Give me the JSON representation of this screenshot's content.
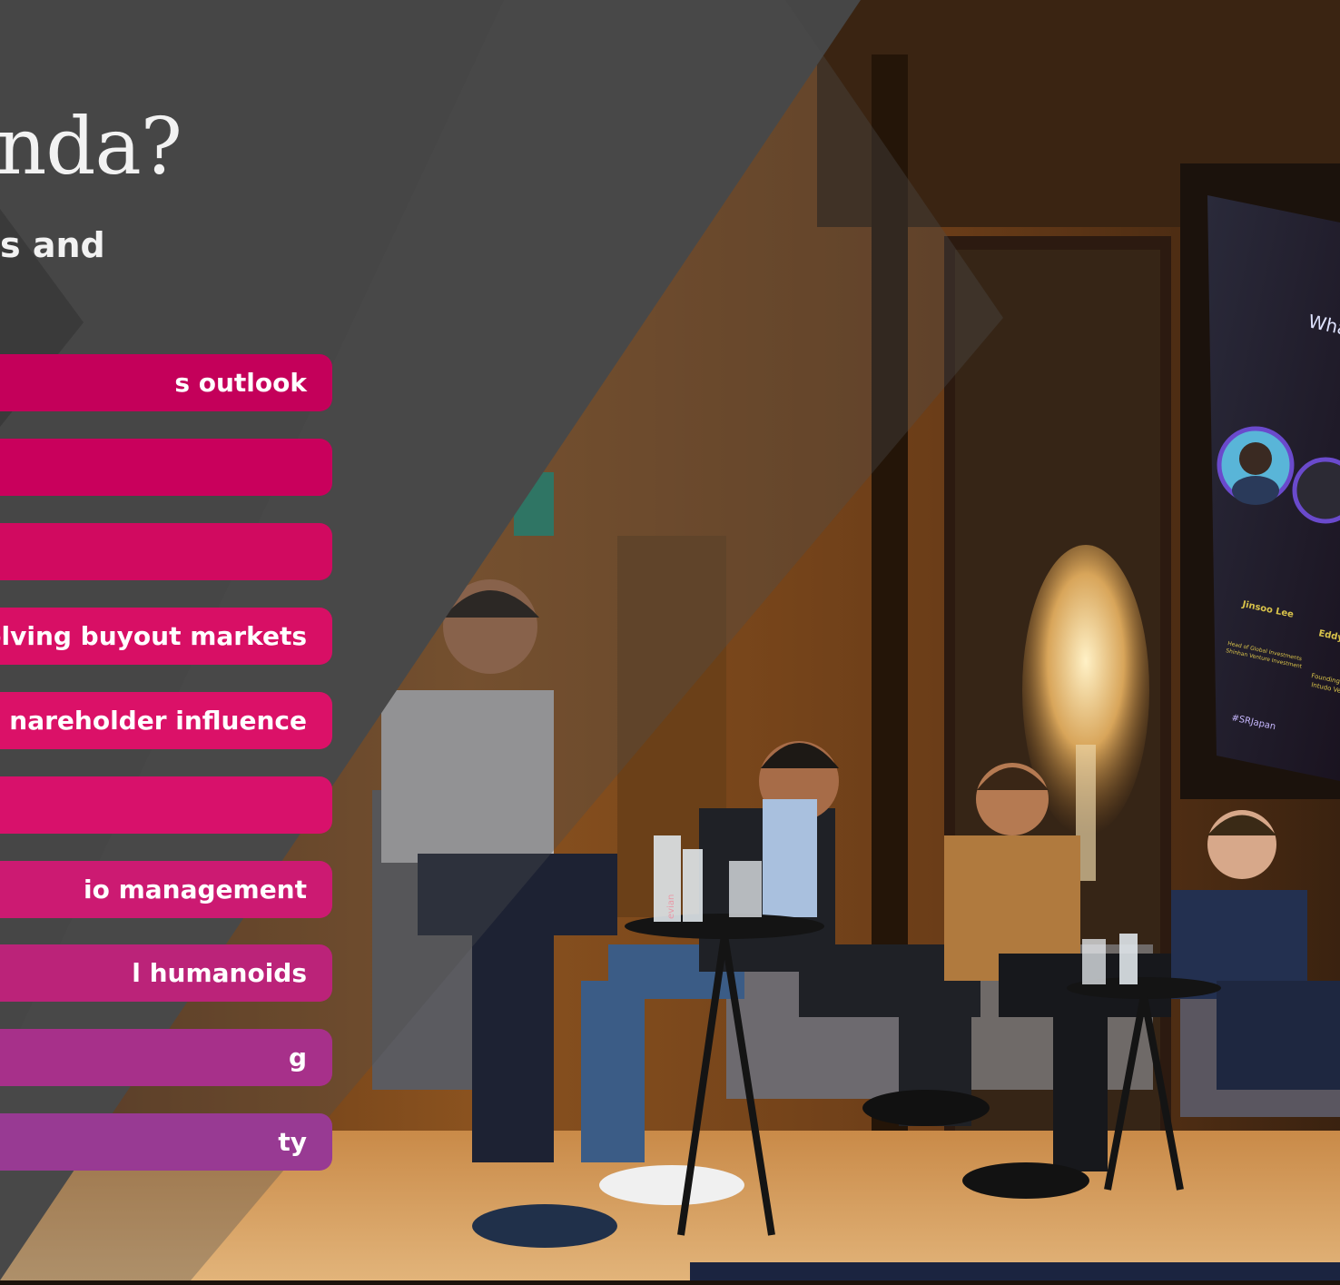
{
  "heading": "nda?",
  "subheading": "s and",
  "topics": [
    {
      "label": "s outlook",
      "color": "#c4005a"
    },
    {
      "label": "",
      "color": "#c9005c"
    },
    {
      "label": "",
      "color": "#d10a60"
    },
    {
      "label": "volving buyout markets",
      "color": "#d80f65"
    },
    {
      "label": "nareholder influence",
      "color": "#db1168"
    },
    {
      "label": "",
      "color": "#d8116b"
    },
    {
      "label": "io management",
      "color": "#cc1a72"
    },
    {
      "label": "l humanoids",
      "color": "#bb2379"
    },
    {
      "label": "g",
      "color": "#a7308a"
    },
    {
      "label": "ty",
      "color": "#983a93"
    }
  ],
  "screen": {
    "title": "What",
    "speaker_1_name": "Jinsoo Lee",
    "speaker_1_title": "Head of Global Investments",
    "speaker_1_org": "Shinhan Venture Investment",
    "speaker_2_name": "Eddy C",
    "speaker_2_title": "Founding P",
    "speaker_2_org": "Intudo Ve",
    "hashtag": "#SRJapan"
  },
  "bottle_brand": "evian"
}
